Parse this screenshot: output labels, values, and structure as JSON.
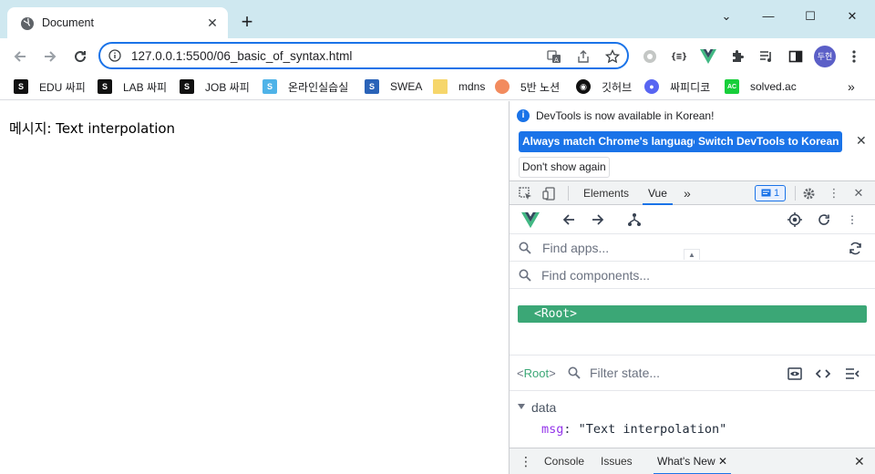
{
  "browser": {
    "tab_title": "Document",
    "url": "127.0.0.1:5500/06_basic_of_syntax.html",
    "avatar_text": "두현",
    "accent_color": "#1a73e8"
  },
  "bookmarks": [
    {
      "label": "EDU 싸피",
      "icon": "ssafy-icon"
    },
    {
      "label": "LAB 싸피",
      "icon": "ssafy-icon"
    },
    {
      "label": "JOB 싸피",
      "icon": "ssafy-icon"
    },
    {
      "label": "온라인실습실",
      "icon": "ssafy-icon"
    },
    {
      "label": "SWEA",
      "icon": "swea-icon"
    },
    {
      "label": "mdns",
      "icon": "folder-icon"
    },
    {
      "label": "5반 노션",
      "icon": "peach-icon"
    },
    {
      "label": "깃허브",
      "icon": "github-icon"
    },
    {
      "label": "싸피디코",
      "icon": "discord-icon"
    },
    {
      "label": "solved.ac",
      "icon": "solvedac-icon"
    }
  ],
  "page": {
    "message": "메시지: Text interpolation"
  },
  "devtools": {
    "info": {
      "text": "DevTools is now available in Korean!",
      "btn_match": "Always match Chrome's language",
      "btn_switch": "Switch DevTools to Korean",
      "btn_dont_show": "Don't show again"
    },
    "tabs": [
      "Elements",
      "Vue"
    ],
    "active_tab": "Vue",
    "issues_count": "1",
    "vue": {
      "find_apps_placeholder": "Find apps...",
      "find_components_placeholder": "Find components...",
      "root_component": "<Root>",
      "state_root": "Root",
      "filter_state_placeholder": "Filter state...",
      "data_section": "data",
      "data_key": "msg",
      "data_value": "\"Text interpolation\"",
      "brand_color": "#3ba776"
    },
    "drawer_tabs": [
      "Console",
      "Issues",
      "What's New"
    ]
  }
}
